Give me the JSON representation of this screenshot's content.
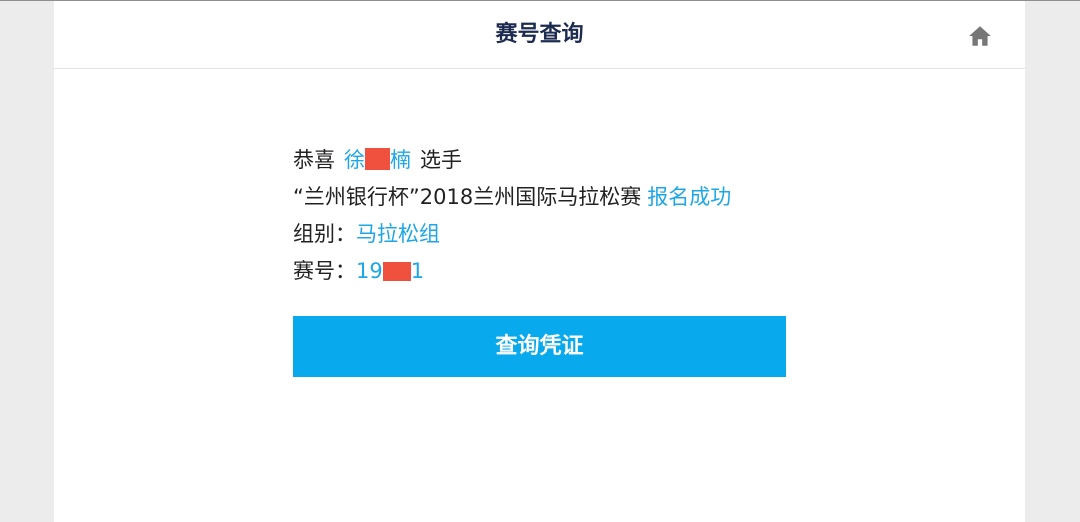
{
  "header": {
    "title": "赛号查询",
    "home_icon": "home-icon"
  },
  "result": {
    "congrats_prefix": "恭喜",
    "name_first": "徐",
    "name_last": "楠",
    "congrats_suffix": "选手",
    "event_name": "“兰州银行杯”2018兰州国际马拉松赛",
    "status": "报名成功",
    "group_label": "组别：",
    "group_value": "马拉松组",
    "bib_label": "赛号：",
    "bib_prefix": "19",
    "bib_suffix": "1"
  },
  "button": {
    "label": "查询凭证"
  },
  "colors": {
    "accent_blue": "#1ea7e6",
    "button_blue": "#09a9ee",
    "title_navy": "#1c2b4f",
    "redaction": "#f0513f"
  }
}
